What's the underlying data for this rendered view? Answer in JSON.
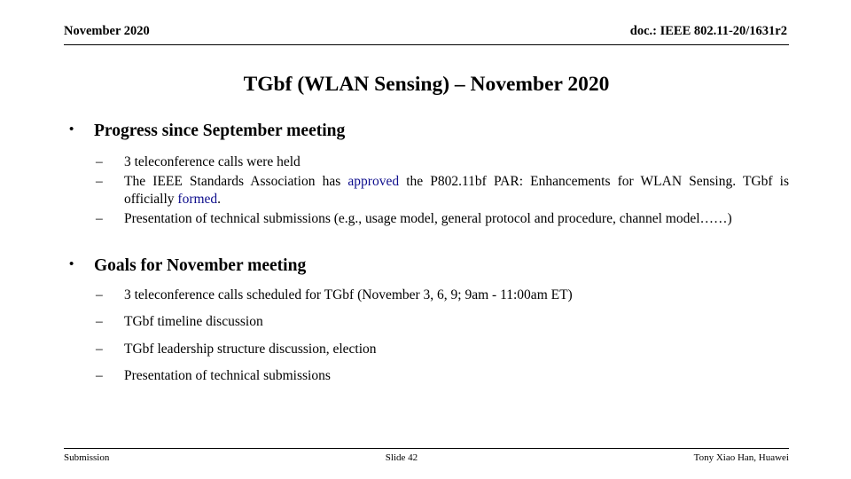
{
  "header": {
    "date": "November 2020",
    "doc": "doc.: IEEE 802.11-20/1631r2"
  },
  "title": "TGbf (WLAN Sensing) – November 2020",
  "content": {
    "section1": {
      "marker": "•",
      "heading": "Progress since September meeting",
      "items": [
        {
          "marker": "–",
          "text": "3 teleconference calls were held"
        },
        {
          "marker": "–",
          "text_before_link1": "The IEEE Standards Association has ",
          "link1": "approved",
          "text_mid": " the P802.11bf PAR: Enhancements for WLAN Sensing. TGbf is officially ",
          "link2": "formed",
          "text_after": "."
        },
        {
          "marker": "–",
          "text": "Presentation of technical submissions (e.g., usage model, general protocol and procedure, channel model……)"
        }
      ]
    },
    "section2": {
      "marker": "•",
      "heading": "Goals for November meeting",
      "items": [
        {
          "marker": "–",
          "text": "3 teleconference calls scheduled for TGbf (November 3, 6, 9; 9am - 11:00am ET)"
        },
        {
          "marker": "–",
          "text": "TGbf timeline discussion"
        },
        {
          "marker": "–",
          "text": "TGbf leadership structure discussion, election"
        },
        {
          "marker": "–",
          "text": "Presentation of technical submissions"
        }
      ]
    }
  },
  "footer": {
    "left": "Submission",
    "center": "Slide 42",
    "right": "Tony Xiao Han, Huawei"
  },
  "colors": {
    "text": "#000000",
    "link": "#0d0d8c",
    "background": "#ffffff"
  }
}
